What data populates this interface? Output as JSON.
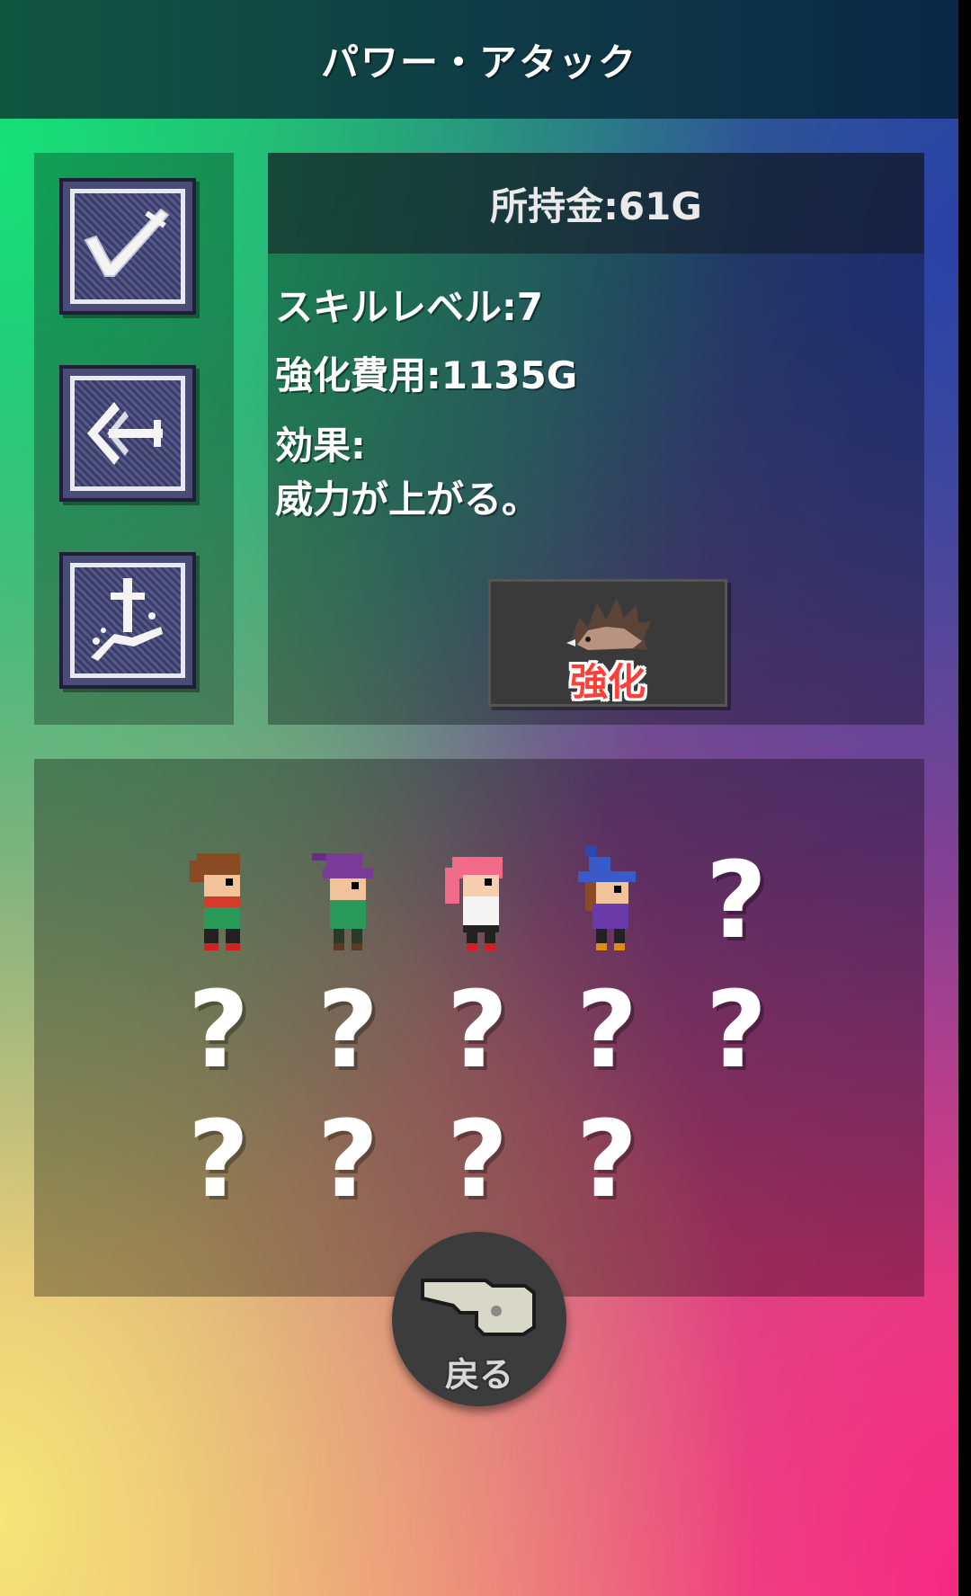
{
  "header": {
    "title": "パワー・アタック"
  },
  "skills": [
    {
      "name": "slash",
      "icon": "downward-slash-skill-icon"
    },
    {
      "name": "pierce",
      "icon": "forward-thrust-skill-icon"
    },
    {
      "name": "rise",
      "icon": "upward-strike-skill-icon"
    }
  ],
  "info": {
    "money": "所持金:61G",
    "skill_level": "スキルレベル:7",
    "cost": "強化費用:1135G",
    "effect_label": "効果:",
    "effect_text": "威力が上がる。",
    "upgrade_label": "強化",
    "upgrade_icon": "hedgehog-power-icon"
  },
  "party": {
    "characters": [
      {
        "icon": "brown-hair-hero-icon"
      },
      {
        "icon": "purple-hat-mage-icon"
      },
      {
        "icon": "pink-hair-girl-icon"
      },
      {
        "icon": "blue-hat-witch-icon"
      }
    ],
    "unknown_mark": "?",
    "unknown_count": 10
  },
  "back": {
    "label": "戻る",
    "icon": "pointing-hand-icon"
  },
  "colors": {
    "upgrade_red": "#ff4038",
    "panel_dark": "#3a3a3a"
  }
}
